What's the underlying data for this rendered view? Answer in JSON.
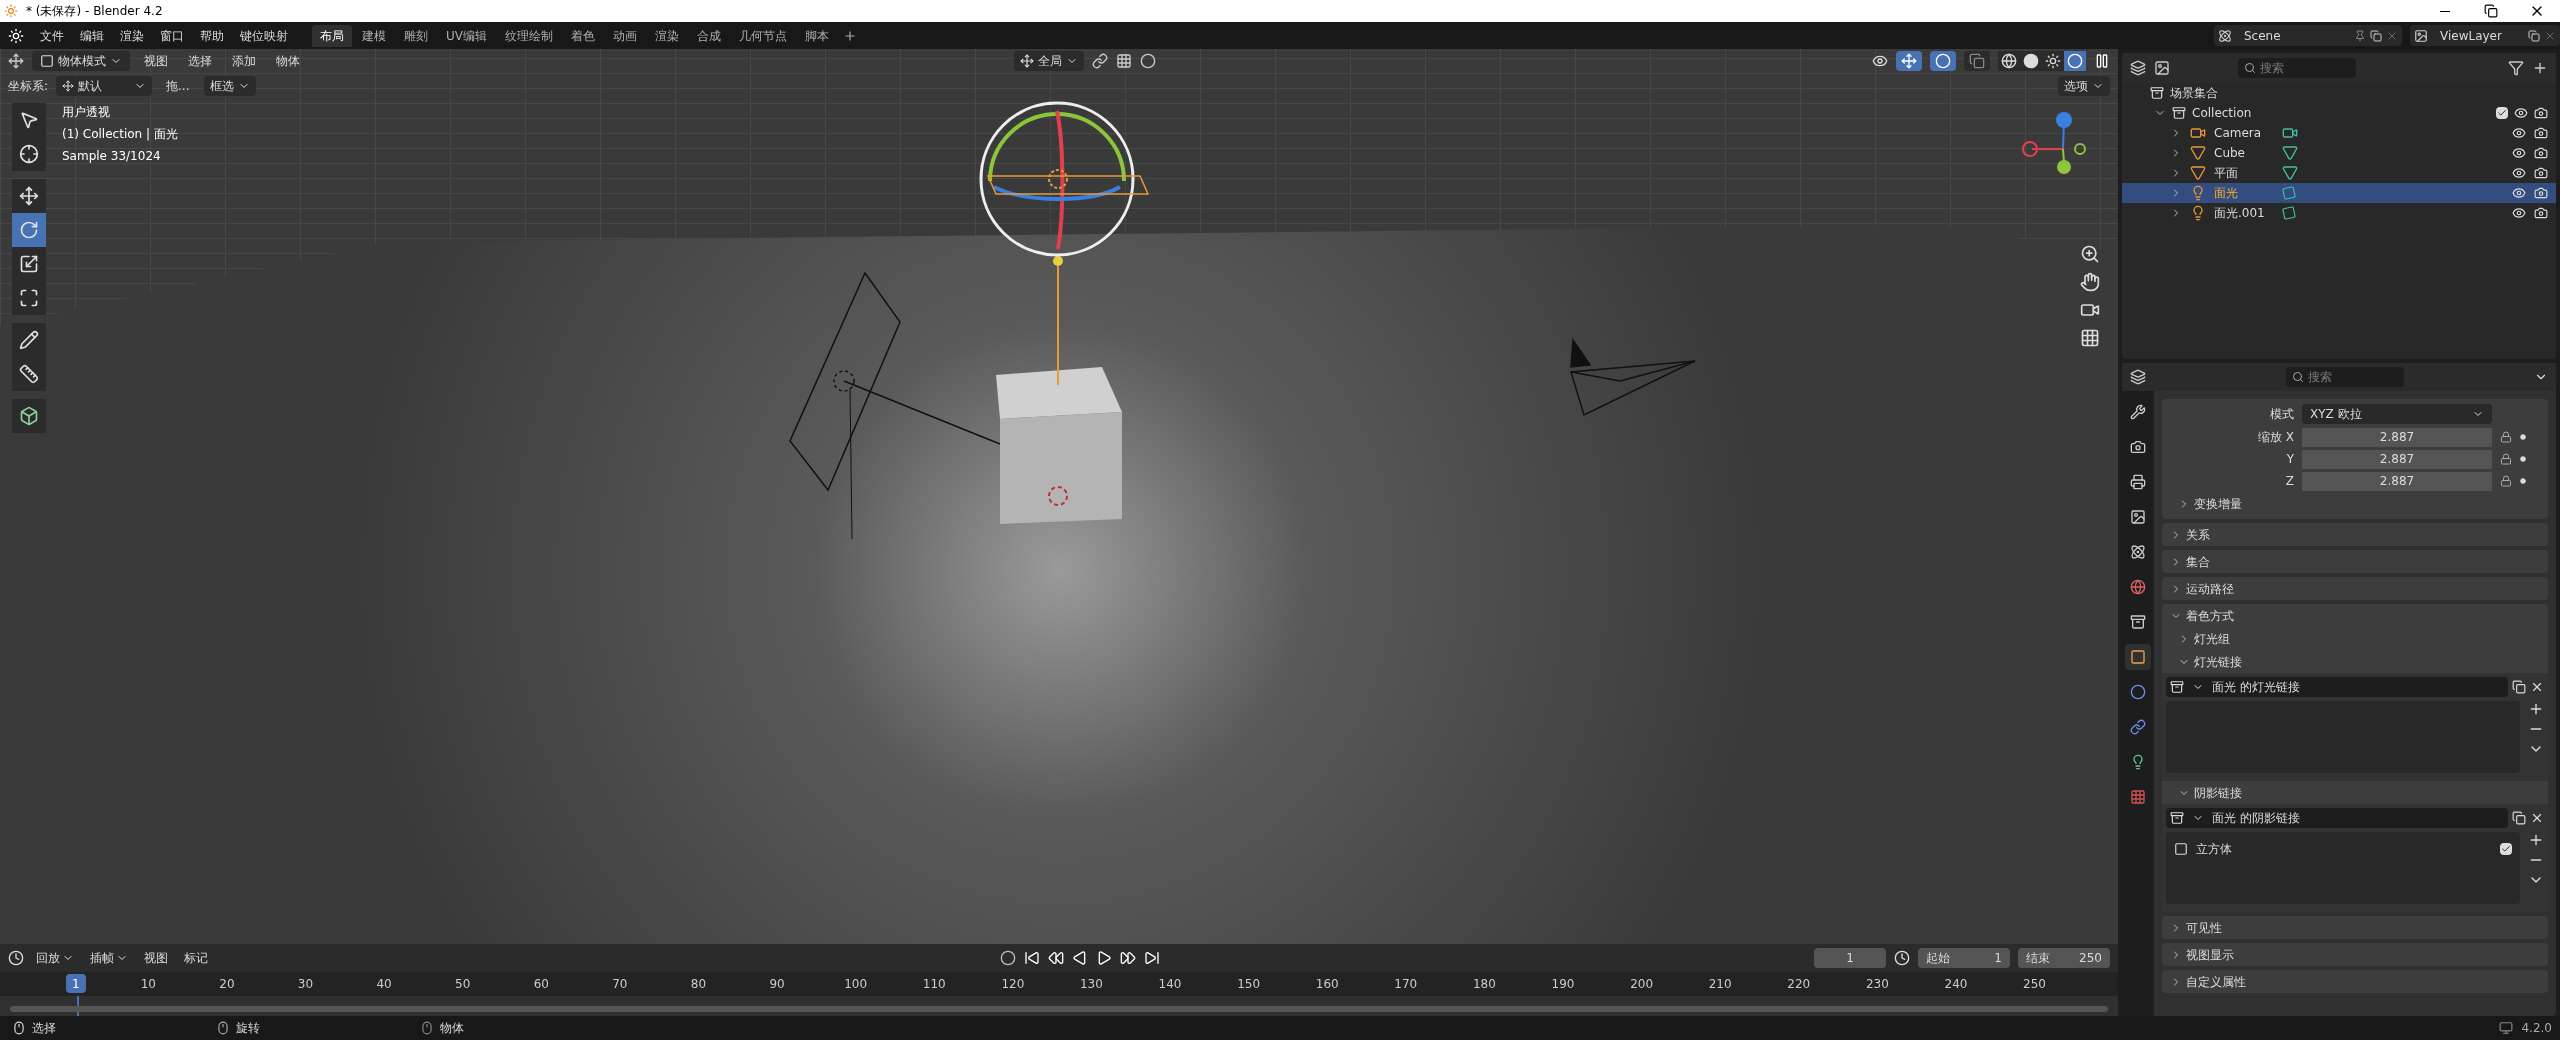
{
  "window": {
    "title": "* (未保存) - Blender 4.2"
  },
  "menu": [
    "文件",
    "编辑",
    "渲染",
    "窗口",
    "帮助",
    "键位映射"
  ],
  "workspaces": [
    {
      "label": "布局",
      "selected": true
    },
    {
      "label": "建模",
      "selected": false
    },
    {
      "label": "雕刻",
      "selected": false
    },
    {
      "label": "UV编辑",
      "selected": false
    },
    {
      "label": "纹理绘制",
      "selected": false
    },
    {
      "label": "着色",
      "selected": false
    },
    {
      "label": "动画",
      "selected": false
    },
    {
      "label": "渲染",
      "selected": false
    },
    {
      "label": "合成",
      "selected": false
    },
    {
      "label": "几何节点",
      "selected": false
    },
    {
      "label": "脚本",
      "selected": false
    }
  ],
  "scene_selector": {
    "scene": "Scene",
    "view_layer": "ViewLayer"
  },
  "viewport": {
    "mode": "物体模式",
    "menus": [
      "视图",
      "选择",
      "添加",
      "物体"
    ],
    "orientation": "全局",
    "coord_label": "坐标系:",
    "coord_value": "默认",
    "drag_label": "拖...",
    "select_mode": "框选",
    "options": "选项",
    "info": [
      "用户透视",
      "(1) Collection | 面光",
      "Sample 33/1024"
    ],
    "toolbar": [
      [
        {
          "kind": "select-box",
          "selected": false
        },
        {
          "kind": "cursor",
          "selected": false
        }
      ],
      [
        {
          "kind": "move",
          "selected": false
        },
        {
          "kind": "rotate",
          "selected": true
        },
        {
          "kind": "scale",
          "selected": false
        },
        {
          "kind": "transform",
          "selected": false
        }
      ],
      [
        {
          "kind": "annotate",
          "selected": false
        },
        {
          "kind": "measure",
          "selected": false
        }
      ],
      [
        {
          "kind": "add-cube",
          "selected": false
        }
      ]
    ],
    "toggles": [
      {
        "kind": "gizmo",
        "on": true
      },
      {
        "kind": "overlay",
        "on": true
      },
      {
        "kind": "xray",
        "on": false
      }
    ],
    "shading": [
      {
        "kind": "wireframe",
        "selected": false
      },
      {
        "kind": "solid",
        "selected": false
      },
      {
        "kind": "material",
        "selected": false
      },
      {
        "kind": "rendered",
        "selected": true
      }
    ]
  },
  "outliner": {
    "search_placeholder": "搜索",
    "root": "场景集合",
    "collections": [
      {
        "label": "Collection",
        "expanded": true,
        "checked": true,
        "children": [
          {
            "label": "Camera",
            "kind": "camera",
            "selected": false
          },
          {
            "label": "Cube",
            "kind": "mesh",
            "selected": false
          },
          {
            "label": "平面",
            "kind": "mesh",
            "selected": false
          },
          {
            "label": "面光",
            "kind": "light",
            "selected": true
          },
          {
            "label": "面光.001",
            "kind": "light",
            "selected": false
          }
        ]
      }
    ]
  },
  "properties": {
    "search_placeholder": "搜索",
    "tabs": [
      {
        "kind": "tool",
        "selected": false
      },
      {
        "kind": "render",
        "selected": false
      },
      {
        "kind": "output",
        "selected": false
      },
      {
        "kind": "view-layer",
        "selected": false
      },
      {
        "kind": "scene",
        "selected": false
      },
      {
        "kind": "world",
        "selected": false
      },
      {
        "kind": "collection",
        "selected": false
      },
      {
        "kind": "object",
        "selected": true
      },
      {
        "kind": "physics",
        "selected": false
      },
      {
        "kind": "constraints",
        "selected": false
      },
      {
        "kind": "light-data",
        "selected": false
      },
      {
        "kind": "texture",
        "selected": false
      }
    ],
    "mode": {
      "label": "模式",
      "value": "XYZ 欧拉"
    },
    "scale": [
      {
        "label": "缩放 X",
        "value": "2.887"
      },
      {
        "label": "Y",
        "value": "2.887"
      },
      {
        "label": "Z",
        "value": "2.887"
      }
    ],
    "transform_delta": {
      "label": "变换增量",
      "expanded": false
    },
    "panels": [
      {
        "label": "关系",
        "expanded": false
      },
      {
        "label": "集合",
        "expanded": false
      },
      {
        "label": "运动路径",
        "expanded": false
      },
      {
        "label": "着色方式",
        "expanded": true,
        "subpanels": [
          {
            "label": "灯光组",
            "expanded": false
          },
          {
            "label": "灯光链接",
            "expanded": true,
            "collection": "面光 的灯光链接"
          },
          {
            "label": "阴影链接",
            "expanded": true,
            "collection": "面光 的阴影链接",
            "items": [
              {
                "label": "立方体",
                "checked": true
              }
            ]
          }
        ]
      },
      {
        "label": "可见性",
        "expanded": false
      },
      {
        "label": "视图显示",
        "expanded": false
      },
      {
        "label": "自定义属性",
        "expanded": false
      }
    ]
  },
  "timeline": {
    "menus": [
      "回放",
      "插帧",
      "视图",
      "标记"
    ],
    "current_frame": "1",
    "start_label": "起始",
    "start": "1",
    "end_label": "结束",
    "end": "250",
    "playhead": "1",
    "ruler": [
      "10",
      "20",
      "30",
      "40",
      "50",
      "60",
      "70",
      "80",
      "90",
      "100",
      "110",
      "120",
      "130",
      "140",
      "150",
      "160",
      "170",
      "180",
      "190",
      "200",
      "210",
      "220",
      "230",
      "240",
      "250"
    ]
  },
  "status_bar": {
    "hints": [
      {
        "kind": "mouse-left",
        "label": "选择"
      },
      {
        "kind": "mouse-middle",
        "label": "旋转"
      },
      {
        "kind": "mouse-right",
        "label": "物体"
      }
    ],
    "version": "4.2.0"
  }
}
